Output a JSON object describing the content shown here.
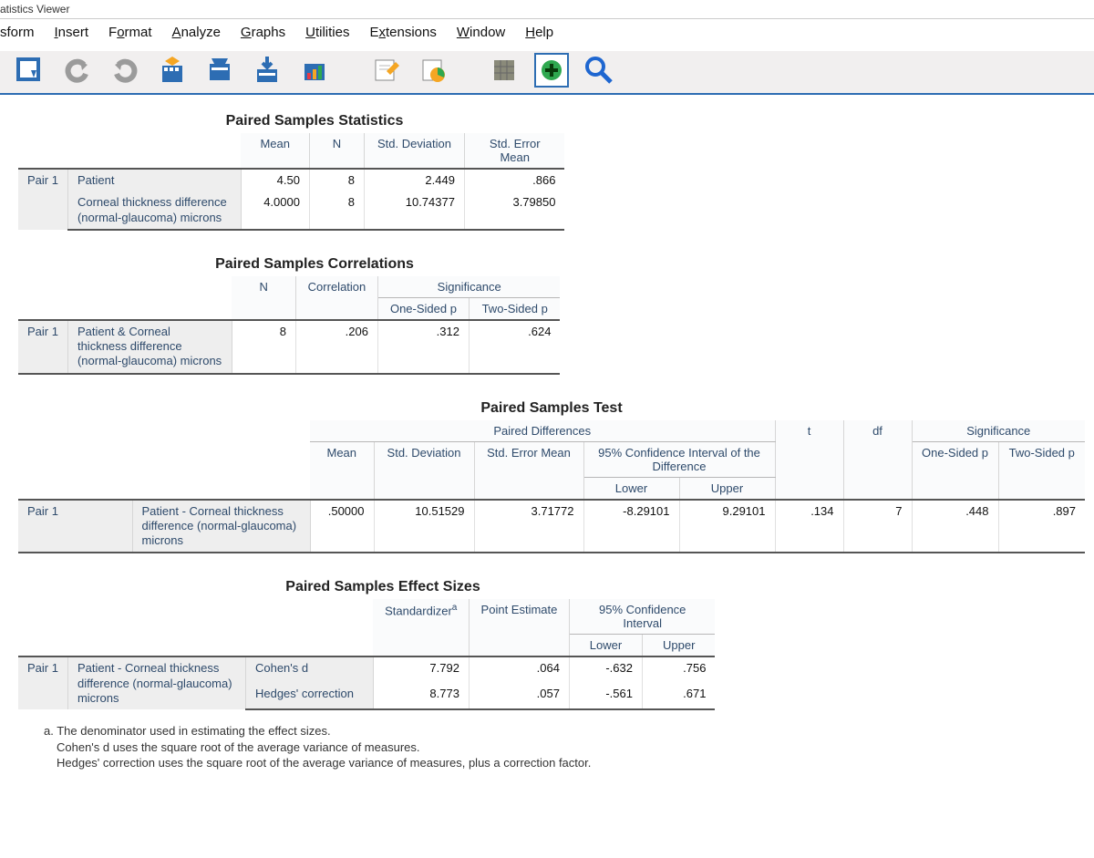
{
  "window": {
    "title": "atistics Viewer"
  },
  "menu": {
    "transform": "sform",
    "insert": "Insert",
    "format": "Format",
    "analyze": "Analyze",
    "graphs": "Graphs",
    "utilities": "Utilities",
    "extensions": "Extensions",
    "window": "Window",
    "help": "Help"
  },
  "table1": {
    "title": "Paired Samples Statistics",
    "headers": {
      "mean": "Mean",
      "n": "N",
      "sd": "Std. Deviation",
      "sem": "Std. Error Mean"
    },
    "pair_label": "Pair 1",
    "rows": [
      {
        "label": "Patient",
        "mean": "4.50",
        "n": "8",
        "sd": "2.449",
        "sem": ".866"
      },
      {
        "label": "Corneal thickness difference (normal-glaucoma) microns",
        "mean": "4.0000",
        "n": "8",
        "sd": "10.74377",
        "sem": "3.79850"
      }
    ]
  },
  "table2": {
    "title": "Paired Samples Correlations",
    "headers": {
      "n": "N",
      "corr": "Correlation",
      "sig": "Significance",
      "p1": "One-Sided p",
      "p2": "Two-Sided p"
    },
    "row": {
      "pair": "Pair 1",
      "label": "Patient & Corneal thickness difference (normal-glaucoma) microns",
      "n": "8",
      "corr": ".206",
      "p1": ".312",
      "p2": ".624"
    }
  },
  "table3": {
    "title": "Paired Samples Test",
    "headers": {
      "pd": "Paired Differences",
      "ci": "95% Confidence Interval of the Difference",
      "mean": "Mean",
      "sd": "Std. Deviation",
      "sem": "Std. Error Mean",
      "lower": "Lower",
      "upper": "Upper",
      "t": "t",
      "df": "df",
      "sig": "Significance",
      "p1": "One-Sided p",
      "p2": "Two-Sided p"
    },
    "row": {
      "pair": "Pair 1",
      "label": "Patient - Corneal thickness difference (normal-glaucoma) microns",
      "mean": ".50000",
      "sd": "10.51529",
      "sem": "3.71772",
      "lower": "-8.29101",
      "upper": "9.29101",
      "t": ".134",
      "df": "7",
      "p1": ".448",
      "p2": ".897"
    }
  },
  "table4": {
    "title": "Paired Samples Effect Sizes",
    "headers": {
      "standardizer": "Standardizer",
      "pe": "Point Estimate",
      "ci": "95% Confidence Interval",
      "lower": "Lower",
      "upper": "Upper"
    },
    "pair_label": "Pair 1",
    "row_label": "Patient - Corneal thickness difference (normal-glaucoma) microns",
    "rows": [
      {
        "name": "Cohen's d",
        "std": "7.792",
        "pe": ".064",
        "lower": "-.632",
        "upper": ".756"
      },
      {
        "name": "Hedges' correction",
        "std": "8.773",
        "pe": ".057",
        "lower": "-.561",
        "upper": ".671"
      }
    ],
    "footnote_a_label": "a.",
    "footnote_a": "The denominator used in estimating the effect sizes.",
    "footnote_b": "Cohen's d uses the square root of the average variance of measures.",
    "footnote_c": "Hedges' correction uses the square root of the average variance of measures, plus a correction factor."
  }
}
